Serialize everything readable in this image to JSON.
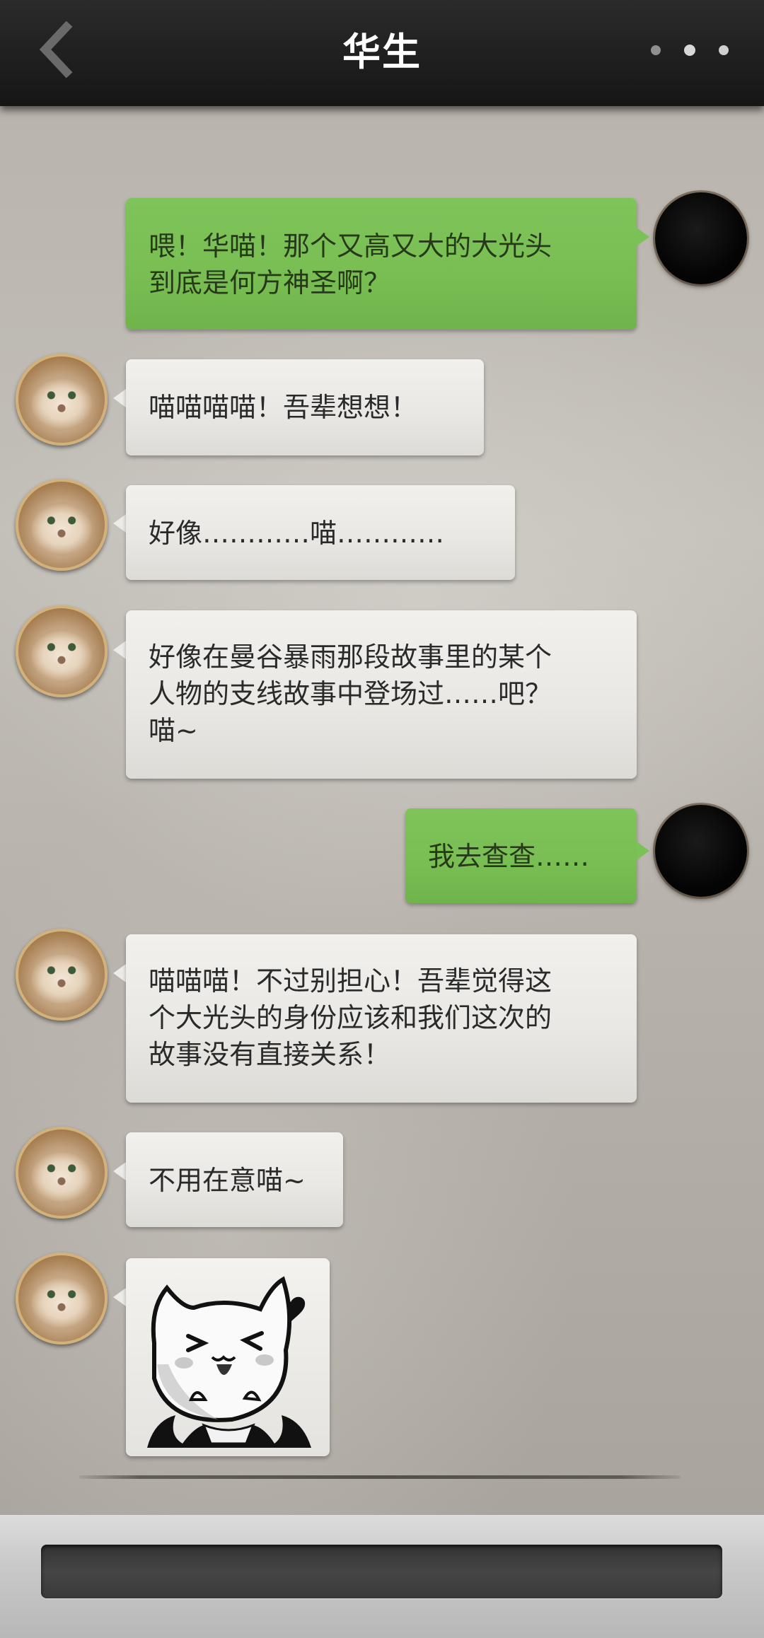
{
  "header": {
    "title": "华生",
    "back_icon": "chevron-left-icon",
    "more_icon": "more-dots-icon"
  },
  "messages": [
    {
      "side": "right",
      "sender": "player",
      "text": "喂！华喵！那个又高又大的大光头\n到底是何方神圣啊？"
    },
    {
      "side": "left",
      "sender": "cat",
      "text": "喵喵喵喵！吾辈想想！"
    },
    {
      "side": "left",
      "sender": "cat",
      "text": "好像…………喵…………"
    },
    {
      "side": "left",
      "sender": "cat",
      "text": "好像在曼谷暴雨那段故事里的某个\n人物的支线故事中登场过……吧？\n喵~"
    },
    {
      "side": "right",
      "sender": "player",
      "text": "我去查查……"
    },
    {
      "side": "left",
      "sender": "cat",
      "text": "喵喵喵！不过别担心！吾辈觉得这\n个大光头的身份应该和我们这次的\n故事没有直接关系！"
    },
    {
      "side": "left",
      "sender": "cat",
      "text": "不用在意喵~"
    },
    {
      "side": "left",
      "sender": "cat",
      "type": "sticker",
      "sticker": "happy-cat-vampire-sticker"
    }
  ],
  "input": {
    "value": "",
    "placeholder": ""
  },
  "colors": {
    "header_bg": "#1e1e1e",
    "green_bubble": "#78be53",
    "gray_bubble": "#e9e8e4",
    "input_bg": "#3a3a3a"
  }
}
